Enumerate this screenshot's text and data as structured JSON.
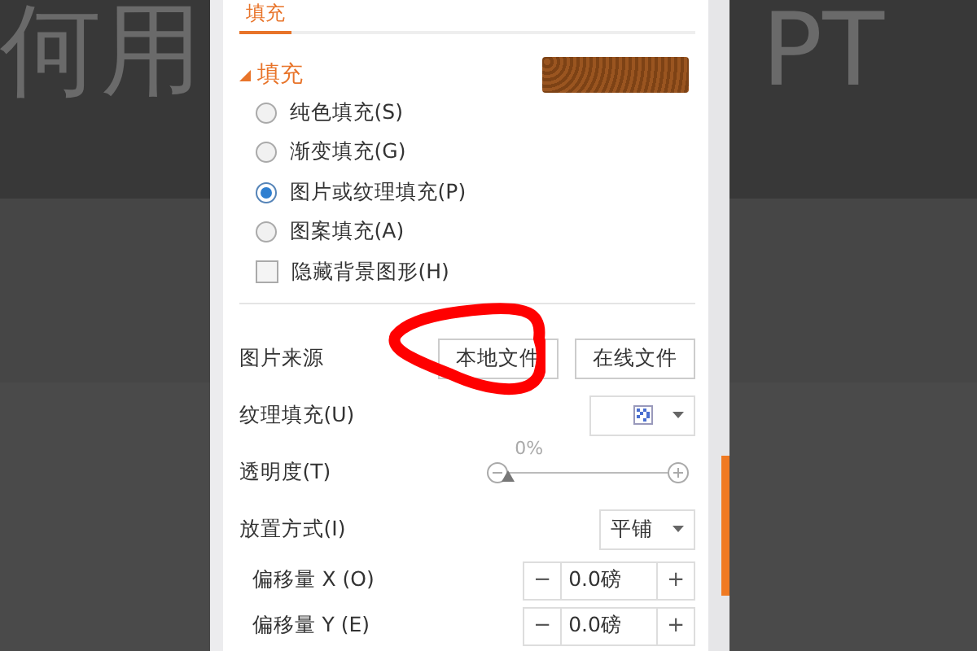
{
  "slide": {
    "left_text": "何用",
    "right_text": "PT"
  },
  "panel": {
    "tabs": [
      {
        "label": "填充",
        "selected": true
      }
    ],
    "section": {
      "title": "填充",
      "expanded": true
    },
    "fill_options": [
      {
        "kind": "radio",
        "label": "纯色填充(S)",
        "selected": false
      },
      {
        "kind": "radio",
        "label": "渐变填充(G)",
        "selected": false
      },
      {
        "kind": "radio",
        "label": "图片或纹理填充(P)",
        "selected": true
      },
      {
        "kind": "radio",
        "label": "图案填充(A)",
        "selected": false
      },
      {
        "kind": "checkbox",
        "label": "隐藏背景图形(H)",
        "checked": false
      }
    ],
    "rows": [
      {
        "kind": "buttons",
        "label": "图片来源",
        "buttons": [
          "本地文件",
          "在线文件"
        ]
      },
      {
        "kind": "pattern",
        "label": "纹理填充(U)"
      },
      {
        "kind": "slider",
        "label": "透明度(T)",
        "reading": "0%",
        "level": 0
      },
      {
        "kind": "dropdown",
        "label": "放置方式(I)",
        "value": "平铺"
      },
      {
        "kind": "spinner",
        "label": "偏移量 X (O)",
        "value": "0.0磅",
        "minus": "−",
        "plus": "+"
      },
      {
        "kind": "spinner",
        "label": "偏移量 Y (E)",
        "value": "0.0磅",
        "minus": "−",
        "plus": "+"
      }
    ]
  }
}
